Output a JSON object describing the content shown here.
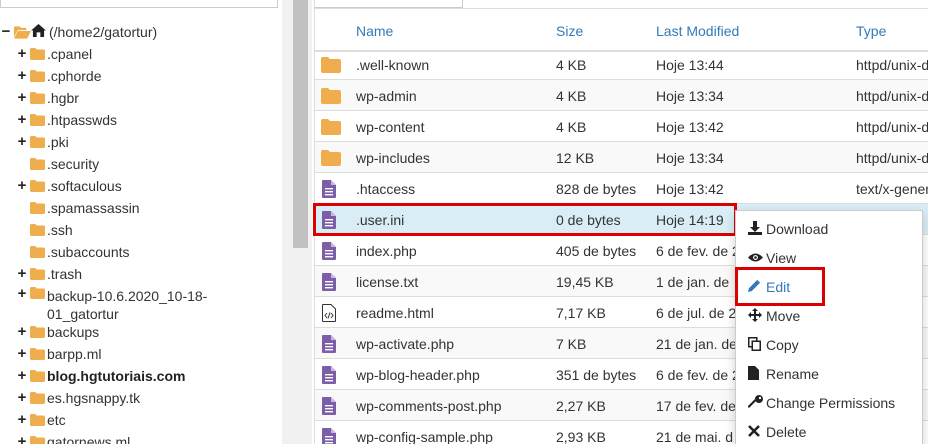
{
  "tree": {
    "root_label": "(/home2/gatortur)",
    "items": [
      {
        "label": ".cpanel",
        "expand": "+"
      },
      {
        "label": ".cphorde",
        "expand": "+"
      },
      {
        "label": ".hgbr",
        "expand": "+"
      },
      {
        "label": ".htpasswds",
        "expand": "+"
      },
      {
        "label": ".pki",
        "expand": "+"
      },
      {
        "label": ".security",
        "expand": ""
      },
      {
        "label": ".softaculous",
        "expand": "+"
      },
      {
        "label": ".spamassassin",
        "expand": ""
      },
      {
        "label": ".ssh",
        "expand": ""
      },
      {
        "label": ".subaccounts",
        "expand": ""
      },
      {
        "label": ".trash",
        "expand": "+"
      },
      {
        "label": "backup-10.6.2020_10-18-",
        "label2": "01_gatortur",
        "expand": "+"
      },
      {
        "label": "backups",
        "expand": "+"
      },
      {
        "label": "barpp.ml",
        "expand": "+"
      },
      {
        "label": "blog.hgtutoriais.com",
        "expand": "+",
        "bold": true
      },
      {
        "label": "es.hgsnappy.tk",
        "expand": "+"
      },
      {
        "label": "etc",
        "expand": "+"
      },
      {
        "label": "gatornews.ml",
        "expand": "+"
      }
    ],
    "root_expand": "−"
  },
  "table": {
    "headers": {
      "name": "Name",
      "size": "Size",
      "modified": "Last Modified",
      "type": "Type"
    },
    "rows": [
      {
        "icon": "folder-icon",
        "name": ".well-known",
        "size": "4 KB",
        "modified": "Hoje 13:44",
        "type": "httpd/unix-d"
      },
      {
        "icon": "folder-icon",
        "name": "wp-admin",
        "size": "4 KB",
        "modified": "Hoje 13:34",
        "type": "httpd/unix-d"
      },
      {
        "icon": "folder-icon",
        "name": "wp-content",
        "size": "4 KB",
        "modified": "Hoje 13:42",
        "type": "httpd/unix-d"
      },
      {
        "icon": "folder-icon",
        "name": "wp-includes",
        "size": "12 KB",
        "modified": "Hoje 13:34",
        "type": "httpd/unix-d"
      },
      {
        "icon": "file-text-icon",
        "name": ".htaccess",
        "size": "828 de bytes",
        "modified": "Hoje 13:42",
        "type": "text/x-gener"
      },
      {
        "icon": "file-text-icon",
        "name": ".user.ini",
        "size": "0 de bytes",
        "modified": "Hoje 14:19",
        "type": ""
      },
      {
        "icon": "file-text-icon",
        "name": "index.php",
        "size": "405 de bytes",
        "modified": "6 de fev. de 2",
        "type": ""
      },
      {
        "icon": "file-text-icon",
        "name": "license.txt",
        "size": "19,45 KB",
        "modified": "1 de jan. de",
        "type": ""
      },
      {
        "icon": "file-code-icon",
        "name": "readme.html",
        "size": "7,17 KB",
        "modified": "6 de jul. de 2",
        "type": ""
      },
      {
        "icon": "file-text-icon",
        "name": "wp-activate.php",
        "size": "7 KB",
        "modified": "21 de jan. de",
        "type": ""
      },
      {
        "icon": "file-text-icon",
        "name": "wp-blog-header.php",
        "size": "351 de bytes",
        "modified": "6 de fev. de 2",
        "type": ""
      },
      {
        "icon": "file-text-icon",
        "name": "wp-comments-post.php",
        "size": "2,27 KB",
        "modified": "17 de fev. de",
        "type": ""
      },
      {
        "icon": "file-text-icon",
        "name": "wp-config-sample.php",
        "size": "2,93 KB",
        "modified": "21 de mai. d",
        "type": ""
      }
    ]
  },
  "context_menu": {
    "items": [
      {
        "icon": "download-icon",
        "label": "Download"
      },
      {
        "icon": "eye-icon",
        "label": "View"
      },
      {
        "icon": "pencil-icon",
        "label": "Edit"
      },
      {
        "icon": "move-icon",
        "label": "Move"
      },
      {
        "icon": "copy-icon",
        "label": "Copy"
      },
      {
        "icon": "file-icon",
        "label": "Rename"
      },
      {
        "icon": "key-icon",
        "label": "Change Permissions"
      },
      {
        "icon": "close-icon",
        "label": "Delete"
      }
    ]
  },
  "colors": {
    "link": "#337ab7",
    "highlight": "#dd0000",
    "folder": "#f0ad4e",
    "file": "#7b5ea7",
    "selected_row": "#d9edf7"
  }
}
